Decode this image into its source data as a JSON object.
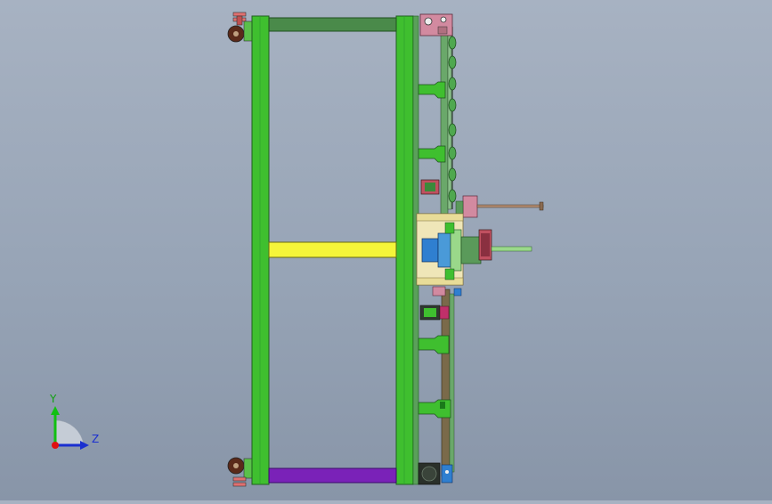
{
  "triad": {
    "y_label": "Y",
    "z_label": "Z",
    "colors": {
      "y": "#11c011",
      "z": "#1a2fd0",
      "x": "#e01010"
    }
  },
  "colors": {
    "background_top": "#a7b2c2",
    "background_bottom": "#8895a8",
    "frame_green": "#3fbf2f",
    "frame_dark_green": "#4a8a4a",
    "beam_yellow": "#f5f53a",
    "beam_purple": "#7a22b8",
    "plate_pink": "#d28aa0",
    "carriage_cream": "#efe6b8",
    "shaft_green": "#9ad88a",
    "motor_blue": "#2f7fd0",
    "brown_rail": "#7a6a4a",
    "wheel_dark": "#5a2a1a"
  }
}
